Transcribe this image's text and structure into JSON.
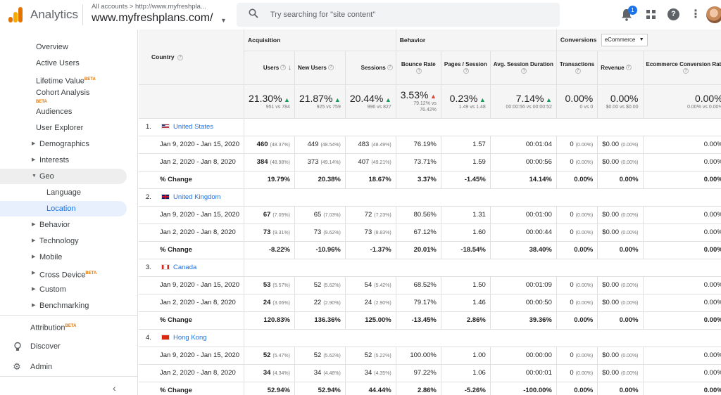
{
  "header": {
    "app_title": "Analytics",
    "breadcrumb": "All accounts > http://www.myfreshpla...",
    "account_name": "www.myfreshplans.com/",
    "search_placeholder": "Try searching for \"site content\"",
    "notification_count": "1"
  },
  "sidebar": {
    "items": [
      {
        "label": "Overview"
      },
      {
        "label": "Active Users"
      },
      {
        "label": "Lifetime Value",
        "badge": "BETA"
      },
      {
        "label": "Cohort Analysis",
        "badge": "BETA"
      },
      {
        "label": "Audiences"
      },
      {
        "label": "User Explorer"
      },
      {
        "label": "Demographics"
      },
      {
        "label": "Interests"
      },
      {
        "label": "Geo"
      },
      {
        "label": "Language"
      },
      {
        "label": "Location"
      },
      {
        "label": "Behavior"
      },
      {
        "label": "Technology"
      },
      {
        "label": "Mobile"
      },
      {
        "label": "Cross Device",
        "badge": "BETA"
      },
      {
        "label": "Custom"
      },
      {
        "label": "Benchmarking"
      }
    ],
    "attribution": {
      "label": "Attribution",
      "badge": "BETA"
    },
    "discover": "Discover",
    "admin": "Admin"
  },
  "table": {
    "dimension_header": "Country",
    "groups": {
      "acquisition": "Acquisition",
      "behavior": "Behavior",
      "conversions": "Conversions",
      "conversion_select": "eCommerce"
    },
    "columns": [
      "Users",
      "New Users",
      "Sessions",
      "Bounce Rate",
      "Pages / Session",
      "Avg. Session Duration",
      "Transactions",
      "Revenue",
      "Ecommerce Conversion Rate"
    ],
    "totals": [
      {
        "value": "21.30%",
        "trend": "up",
        "sub": "951 vs 784"
      },
      {
        "value": "21.87%",
        "trend": "up",
        "sub": "925 vs 759"
      },
      {
        "value": "20.44%",
        "trend": "up",
        "sub": "996 vs 827"
      },
      {
        "value": "3.53%",
        "trend": "down",
        "sub": "79.12% vs 76.42%"
      },
      {
        "value": "0.23%",
        "trend": "up",
        "sub": "1.49 vs 1.48"
      },
      {
        "value": "7.14%",
        "trend": "up",
        "sub": "00:00:56 vs 00:00:52"
      },
      {
        "value": "0.00%",
        "trend": "",
        "sub": "0 vs 0"
      },
      {
        "value": "0.00%",
        "trend": "",
        "sub": "$0.00 vs $0.00"
      },
      {
        "value": "0.00%",
        "trend": "",
        "sub": "0.00% vs 0.00%"
      }
    ],
    "countries": [
      {
        "index": "1.",
        "name": "United States",
        "flag": "us",
        "rows": [
          {
            "label": "Jan 9, 2020 - Jan 15, 2020",
            "cells": [
              [
                "460",
                "(48.37%)"
              ],
              [
                "449",
                "(48.54%)"
              ],
              [
                "483",
                "(48.49%)"
              ],
              [
                "76.19%",
                ""
              ],
              [
                "1.57",
                ""
              ],
              [
                "00:01:04",
                ""
              ],
              [
                "0",
                "(0.00%)"
              ],
              [
                "$0.00",
                "(0.00%)"
              ],
              [
                "0.00%",
                ""
              ]
            ]
          },
          {
            "label": "Jan 2, 2020 - Jan 8, 2020",
            "cells": [
              [
                "384",
                "(48.98%)"
              ],
              [
                "373",
                "(49.14%)"
              ],
              [
                "407",
                "(49.21%)"
              ],
              [
                "73.71%",
                ""
              ],
              [
                "1.59",
                ""
              ],
              [
                "00:00:56",
                ""
              ],
              [
                "0",
                "(0.00%)"
              ],
              [
                "$0.00",
                "(0.00%)"
              ],
              [
                "0.00%",
                ""
              ]
            ]
          },
          {
            "label": "% Change",
            "change": true,
            "cells": [
              [
                "19.79%",
                ""
              ],
              [
                "20.38%",
                ""
              ],
              [
                "18.67%",
                ""
              ],
              [
                "3.37%",
                ""
              ],
              [
                "-1.45%",
                ""
              ],
              [
                "14.14%",
                ""
              ],
              [
                "0.00%",
                ""
              ],
              [
                "0.00%",
                ""
              ],
              [
                "0.00%",
                ""
              ]
            ]
          }
        ]
      },
      {
        "index": "2.",
        "name": "United Kingdom",
        "flag": "gb",
        "rows": [
          {
            "label": "Jan 9, 2020 - Jan 15, 2020",
            "cells": [
              [
                "67",
                "(7.05%)"
              ],
              [
                "65",
                "(7.03%)"
              ],
              [
                "72",
                "(7.23%)"
              ],
              [
                "80.56%",
                ""
              ],
              [
                "1.31",
                ""
              ],
              [
                "00:01:00",
                ""
              ],
              [
                "0",
                "(0.00%)"
              ],
              [
                "$0.00",
                "(0.00%)"
              ],
              [
                "0.00%",
                ""
              ]
            ]
          },
          {
            "label": "Jan 2, 2020 - Jan 8, 2020",
            "cells": [
              [
                "73",
                "(9.31%)"
              ],
              [
                "73",
                "(9.62%)"
              ],
              [
                "73",
                "(8.83%)"
              ],
              [
                "67.12%",
                ""
              ],
              [
                "1.60",
                ""
              ],
              [
                "00:00:44",
                ""
              ],
              [
                "0",
                "(0.00%)"
              ],
              [
                "$0.00",
                "(0.00%)"
              ],
              [
                "0.00%",
                ""
              ]
            ]
          },
          {
            "label": "% Change",
            "change": true,
            "cells": [
              [
                "-8.22%",
                ""
              ],
              [
                "-10.96%",
                ""
              ],
              [
                "-1.37%",
                ""
              ],
              [
                "20.01%",
                ""
              ],
              [
                "-18.54%",
                ""
              ],
              [
                "38.40%",
                ""
              ],
              [
                "0.00%",
                ""
              ],
              [
                "0.00%",
                ""
              ],
              [
                "0.00%",
                ""
              ]
            ]
          }
        ]
      },
      {
        "index": "3.",
        "name": "Canada",
        "flag": "ca",
        "rows": [
          {
            "label": "Jan 9, 2020 - Jan 15, 2020",
            "cells": [
              [
                "53",
                "(5.57%)"
              ],
              [
                "52",
                "(5.62%)"
              ],
              [
                "54",
                "(5.42%)"
              ],
              [
                "68.52%",
                ""
              ],
              [
                "1.50",
                ""
              ],
              [
                "00:01:09",
                ""
              ],
              [
                "0",
                "(0.00%)"
              ],
              [
                "$0.00",
                "(0.00%)"
              ],
              [
                "0.00%",
                ""
              ]
            ]
          },
          {
            "label": "Jan 2, 2020 - Jan 8, 2020",
            "cells": [
              [
                "24",
                "(3.06%)"
              ],
              [
                "22",
                "(2.90%)"
              ],
              [
                "24",
                "(2.90%)"
              ],
              [
                "79.17%",
                ""
              ],
              [
                "1.46",
                ""
              ],
              [
                "00:00:50",
                ""
              ],
              [
                "0",
                "(0.00%)"
              ],
              [
                "$0.00",
                "(0.00%)"
              ],
              [
                "0.00%",
                ""
              ]
            ]
          },
          {
            "label": "% Change",
            "change": true,
            "cells": [
              [
                "120.83%",
                ""
              ],
              [
                "136.36%",
                ""
              ],
              [
                "125.00%",
                ""
              ],
              [
                "-13.45%",
                ""
              ],
              [
                "2.86%",
                ""
              ],
              [
                "39.36%",
                ""
              ],
              [
                "0.00%",
                ""
              ],
              [
                "0.00%",
                ""
              ],
              [
                "0.00%",
                ""
              ]
            ]
          }
        ]
      },
      {
        "index": "4.",
        "name": "Hong Kong",
        "flag": "hk",
        "rows": [
          {
            "label": "Jan 9, 2020 - Jan 15, 2020",
            "cells": [
              [
                "52",
                "(5.47%)"
              ],
              [
                "52",
                "(5.62%)"
              ],
              [
                "52",
                "(5.22%)"
              ],
              [
                "100.00%",
                ""
              ],
              [
                "1.00",
                ""
              ],
              [
                "00:00:00",
                ""
              ],
              [
                "0",
                "(0.00%)"
              ],
              [
                "$0.00",
                "(0.00%)"
              ],
              [
                "0.00%",
                ""
              ]
            ]
          },
          {
            "label": "Jan 2, 2020 - Jan 8, 2020",
            "cells": [
              [
                "34",
                "(4.34%)"
              ],
              [
                "34",
                "(4.48%)"
              ],
              [
                "34",
                "(4.35%)"
              ],
              [
                "97.22%",
                ""
              ],
              [
                "1.06",
                ""
              ],
              [
                "00:00:01",
                ""
              ],
              [
                "0",
                "(0.00%)"
              ],
              [
                "$0.00",
                "(0.00%)"
              ],
              [
                "0.00%",
                ""
              ]
            ]
          },
          {
            "label": "% Change",
            "change": true,
            "cells": [
              [
                "52.94%",
                ""
              ],
              [
                "52.94%",
                ""
              ],
              [
                "44.44%",
                ""
              ],
              [
                "2.86%",
                ""
              ],
              [
                "-5.26%",
                ""
              ],
              [
                "-100.00%",
                ""
              ],
              [
                "0.00%",
                ""
              ],
              [
                "0.00%",
                ""
              ],
              [
                "0.00%",
                ""
              ]
            ]
          }
        ]
      }
    ]
  }
}
